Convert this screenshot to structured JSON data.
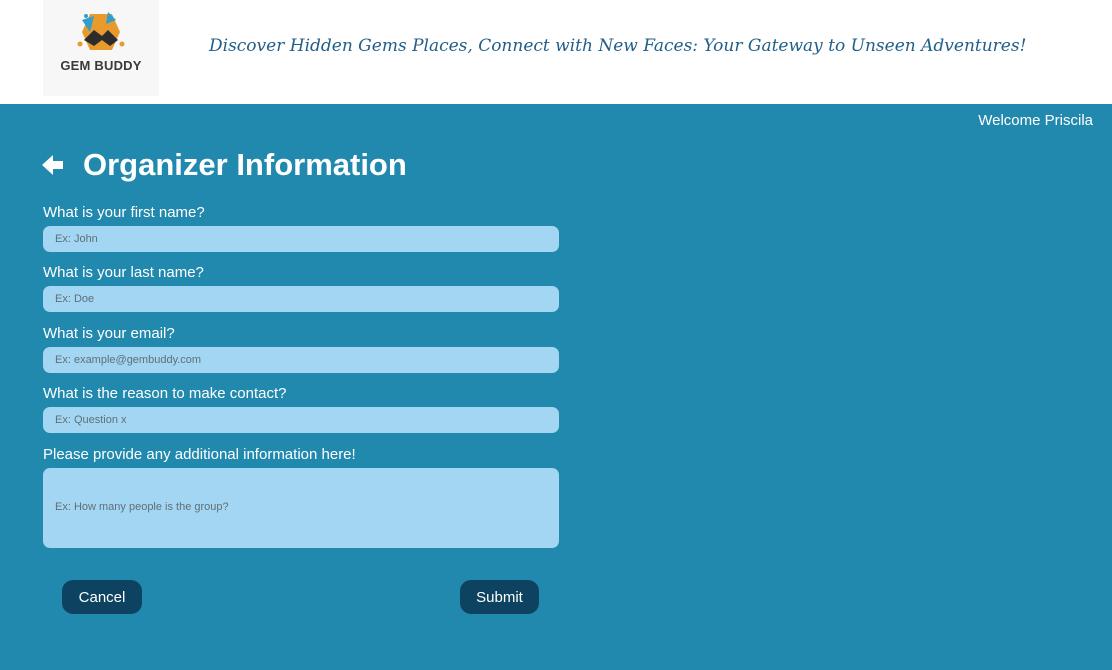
{
  "header": {
    "logo_text": "GEM BUDDY",
    "tagline": "Discover Hidden Gems Places, Connect with New Faces: Your Gateway to Unseen Adventures!"
  },
  "user": {
    "welcome": "Welcome Priscila"
  },
  "page": {
    "title": "Organizer Information",
    "back_icon": "arrow-left-icon"
  },
  "form": {
    "first_name": {
      "label": "What is your first name?",
      "placeholder": "Ex: John",
      "value": ""
    },
    "last_name": {
      "label": "What is your last name?",
      "placeholder": "Ex: Doe",
      "value": ""
    },
    "email": {
      "label": "What is your email?",
      "placeholder": "Ex: example@gembuddy.com",
      "value": ""
    },
    "reason": {
      "label": "What is the reason to make contact?",
      "placeholder": "Ex: Question x",
      "value": ""
    },
    "additional": {
      "label": "Please provide any additional information here!",
      "placeholder": "Ex: How many people is the group?",
      "value": ""
    }
  },
  "actions": {
    "cancel_label": "Cancel",
    "submit_label": "Submit"
  },
  "colors": {
    "background": "#2289ae",
    "header_bg": "#ffffff",
    "input_bg": "#a3d6f2",
    "button_bg": "#0d4360",
    "tagline": "#215f8a"
  }
}
